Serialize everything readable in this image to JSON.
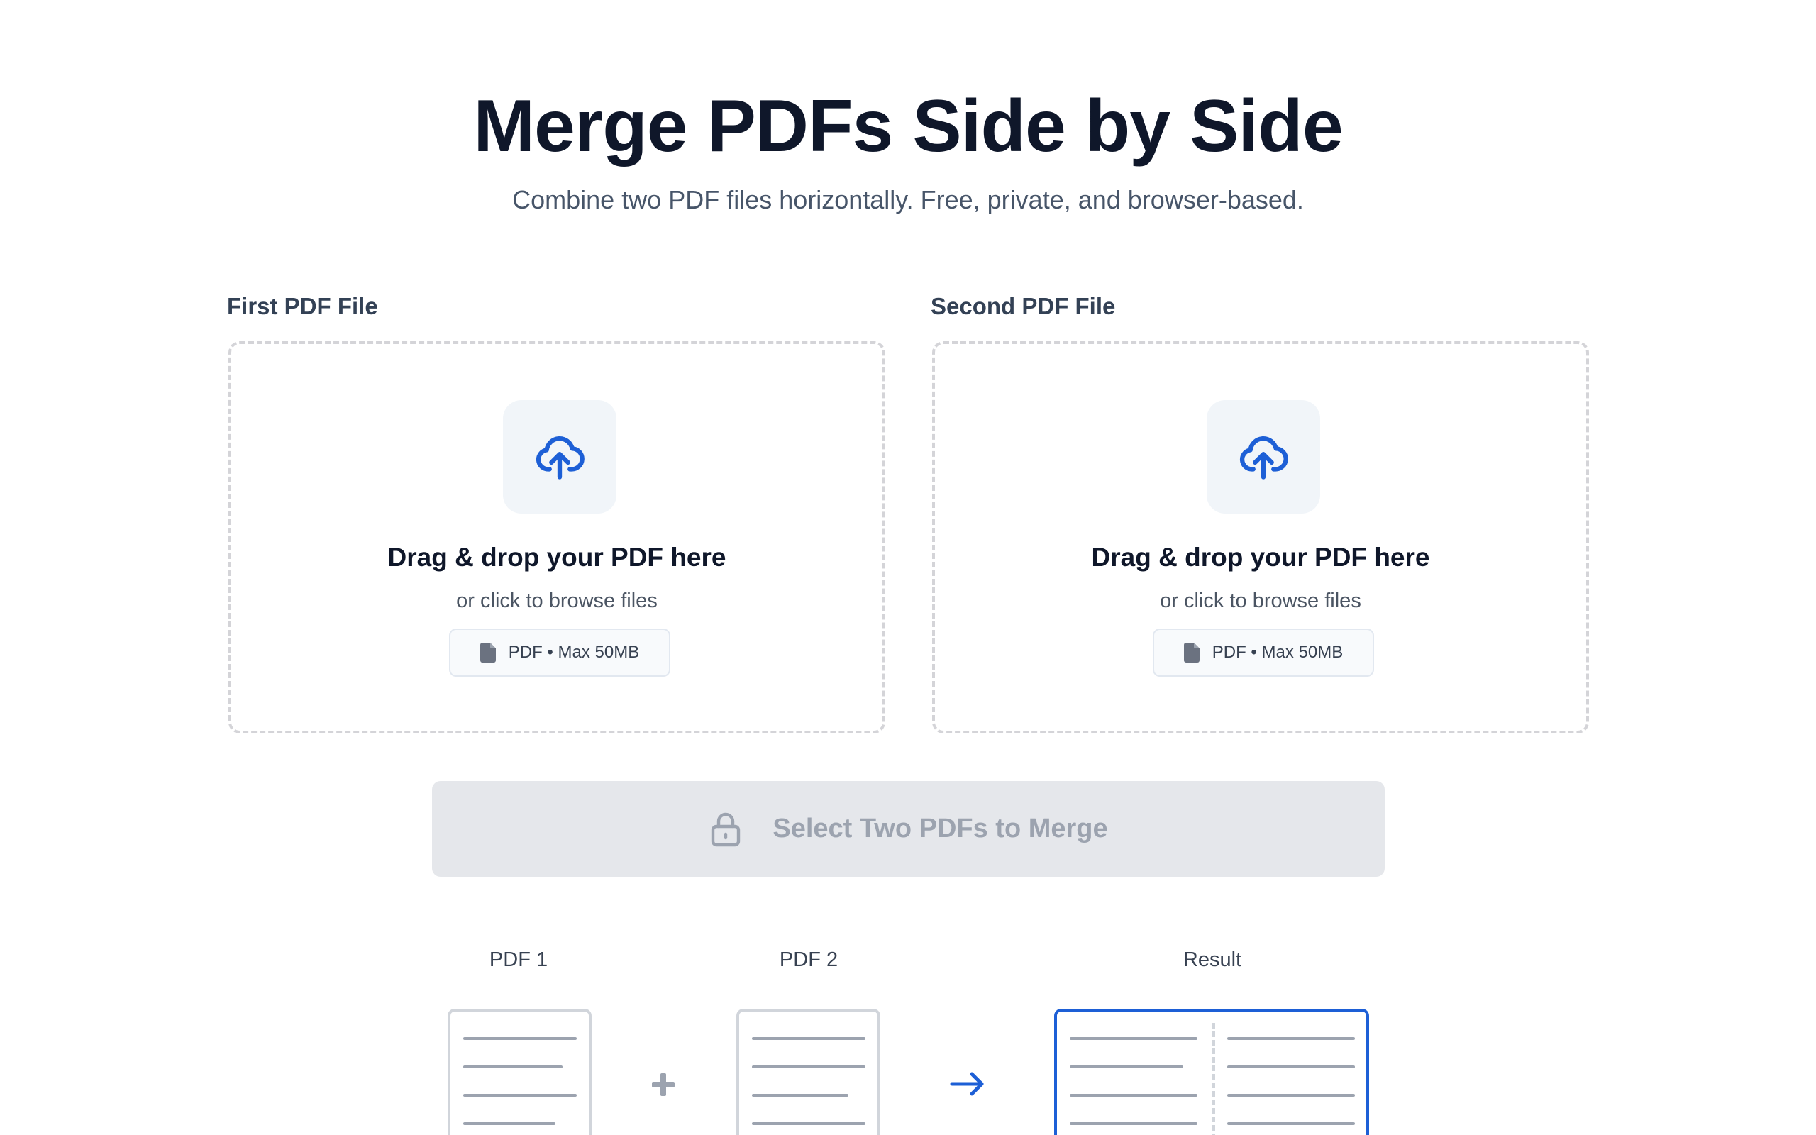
{
  "header": {
    "title": "Merge PDFs Side by Side",
    "subtitle": "Combine two PDF files horizontally. Free, private, and browser-based."
  },
  "upload": {
    "first": {
      "label": "First PDF File",
      "heading": "Drag & drop your PDF here",
      "subtext": "or click to browse files",
      "hint": "PDF • Max 50MB"
    },
    "second": {
      "label": "Second PDF File",
      "heading": "Drag & drop your PDF here",
      "subtext": "or click to browse files",
      "hint": "PDF • Max 50MB"
    }
  },
  "merge_button": {
    "label": "Select Two PDFs to Merge",
    "icon": "lock-icon",
    "state": "disabled"
  },
  "diagram": {
    "pdf1_label": "PDF 1",
    "pdf2_label": "PDF 2",
    "result_label": "Result",
    "operator_icon": "plus-icon",
    "result_icon": "arrow-right-icon"
  },
  "colors": {
    "accent": "#1d5fd6",
    "title": "#0f172a",
    "button_disabled_bg": "#e5e7eb",
    "button_disabled_text": "#9ca3af"
  }
}
